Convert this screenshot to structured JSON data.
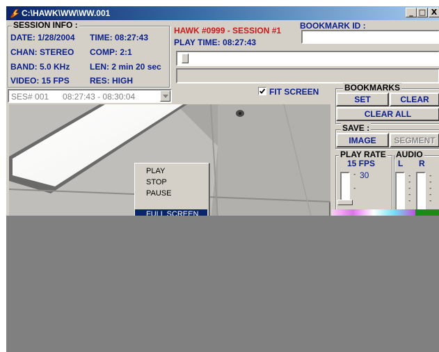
{
  "window": {
    "title": "C:\\HAWK\\WW\\WW.001",
    "controls": {
      "minimize": "_",
      "maximize": "□",
      "close": "X"
    }
  },
  "session_info": {
    "heading": "SESSION INFO :",
    "date": "DATE: 1/28/2004",
    "time": "TIME: 08:27:43",
    "chan": "CHAN: STEREO",
    "comp": "COMP: 2:1",
    "band": "BAND: 5.0 KHz",
    "len": "LEN: 2 min 20 sec",
    "video": "VIDEO: 15 FPS",
    "res": "RES: HIGH"
  },
  "header": {
    "hawk_session": "HAWK #0999 - SESSION #1",
    "play_time": "PLAY TIME: 08:27:43",
    "bookmark_label": "BOOKMARK ID :",
    "bookmark_value": ""
  },
  "session_select": {
    "selected": "SES# 001      08:27:43 - 08:30:04"
  },
  "fit_screen": {
    "label": "FIT SCREEN",
    "checked": true
  },
  "bookmarks": {
    "heading": "BOOKMARKS",
    "set": "SET",
    "clear": "CLEAR",
    "clear_all": "CLEAR ALL"
  },
  "save": {
    "heading": "SAVE :",
    "image": "IMAGE",
    "segment": "SEGMENT"
  },
  "play_rate": {
    "heading": "PLAY RATE",
    "value": "15 FPS",
    "tick_label": "30"
  },
  "audio": {
    "heading": "AUDIO",
    "left": "L",
    "right": "R"
  },
  "context_menu": {
    "items": [
      "PLAY",
      "STOP",
      "PAUSE",
      "FULL SCREEN"
    ]
  },
  "colors": {
    "accent_blue": "#0a1e8c",
    "session_red": "#cc1a1a",
    "titlebar": "#0a246a",
    "face": "#d4d0c8"
  }
}
